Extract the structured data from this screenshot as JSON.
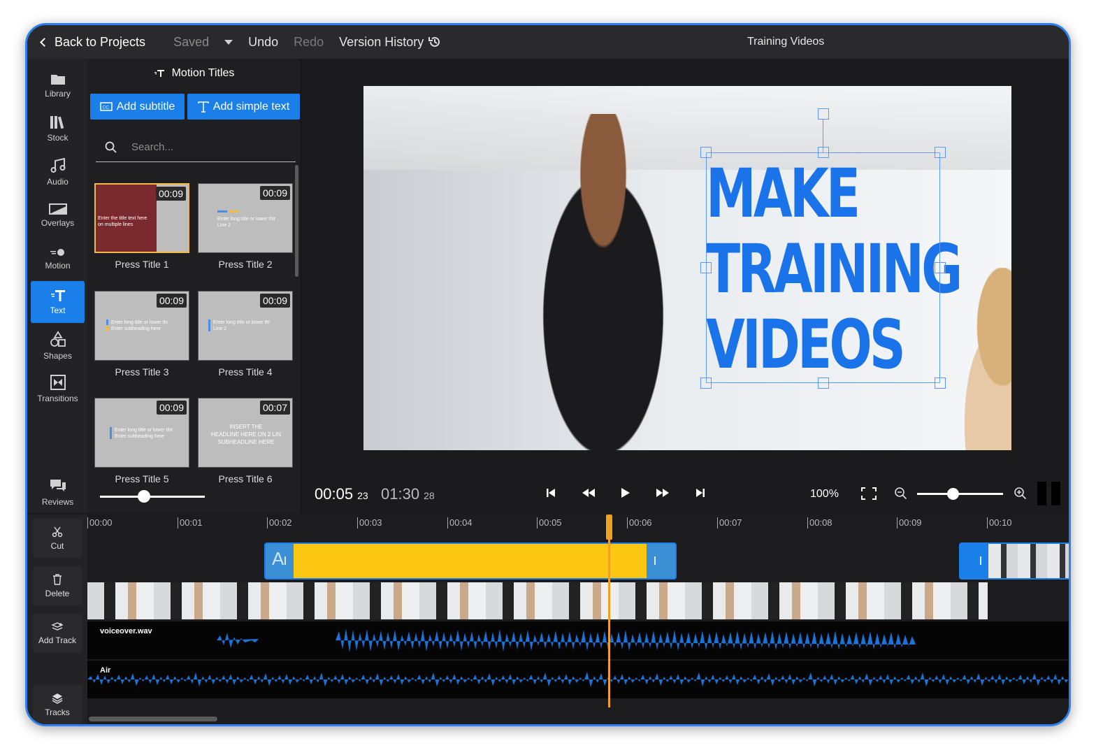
{
  "topbar": {
    "back_label": "Back to Projects",
    "saved_label": "Saved",
    "undo_label": "Undo",
    "redo_label": "Redo",
    "version_history_label": "Version History",
    "project_title": "Training Videos"
  },
  "sidebar": {
    "items": [
      {
        "label": "Library",
        "icon": "folder-icon"
      },
      {
        "label": "Stock",
        "icon": "books-icon"
      },
      {
        "label": "Audio",
        "icon": "music-note-icon"
      },
      {
        "label": "Overlays",
        "icon": "overlay-icon"
      },
      {
        "label": "Motion",
        "icon": "motion-icon"
      },
      {
        "label": "Text",
        "icon": "text-icon",
        "active": true
      },
      {
        "label": "Shapes",
        "icon": "shapes-icon"
      },
      {
        "label": "Transitions",
        "icon": "transitions-icon"
      },
      {
        "label": "Reviews",
        "icon": "chat-icon"
      }
    ]
  },
  "panel": {
    "title": "Motion Titles",
    "add_subtitle_label": "Add subtitle",
    "add_simple_text_label": "Add simple text",
    "search_placeholder": "Search...",
    "templates": [
      {
        "name": "Press Title 1",
        "duration": "00:09",
        "preview_text": "Enter the title text here\non multiple lines",
        "selected": true
      },
      {
        "name": "Press Title 2",
        "duration": "00:09",
        "preview_text": "Enter long title or lower thir\nLine 2"
      },
      {
        "name": "Press Title 3",
        "duration": "00:09",
        "preview_text": "Enter long title or lower thi\nEnter subheading here"
      },
      {
        "name": "Press Title 4",
        "duration": "00:09",
        "preview_text": "Enter long title or lower thi\nLine 2"
      },
      {
        "name": "Press Title 5",
        "duration": "00:09",
        "preview_text": "Enter long title or lower thir\nEnter subheading here"
      },
      {
        "name": "Press Title 6",
        "duration": "00:07",
        "preview_text": "INSERT THE\nHEADLINE HERE ON 2 LIN\nSUBHEADLINE HERE"
      }
    ]
  },
  "preview": {
    "overlay_lines": [
      "MAKE",
      "TRAINING",
      "VIDEOS"
    ],
    "text_color": "#1a73e8"
  },
  "transport": {
    "current_time": "00:05",
    "current_frames": "23",
    "total_time": "01:30",
    "total_frames": "28",
    "zoom_percent": "100%",
    "timeline_zoom_level": 0.42
  },
  "timeline": {
    "tools": [
      {
        "label": "Cut",
        "icon": "scissors-icon"
      },
      {
        "label": "Delete",
        "icon": "trash-icon"
      },
      {
        "label": "Add Track",
        "icon": "add-track-icon"
      },
      {
        "label": "Tracks",
        "icon": "layers-icon"
      }
    ],
    "ruler_ticks": [
      "00:00",
      "00:01",
      "00:02",
      "00:03",
      "00:04",
      "00:05",
      "00:06",
      "00:07",
      "00:08",
      "00:09",
      "00:10"
    ],
    "tracks": [
      {
        "name": "voiceover.wav"
      },
      {
        "name": "Air"
      }
    ],
    "accent_color": "#1a7fe9",
    "playhead_color": "#f0a020",
    "text_clip_color": "#fbc712"
  }
}
